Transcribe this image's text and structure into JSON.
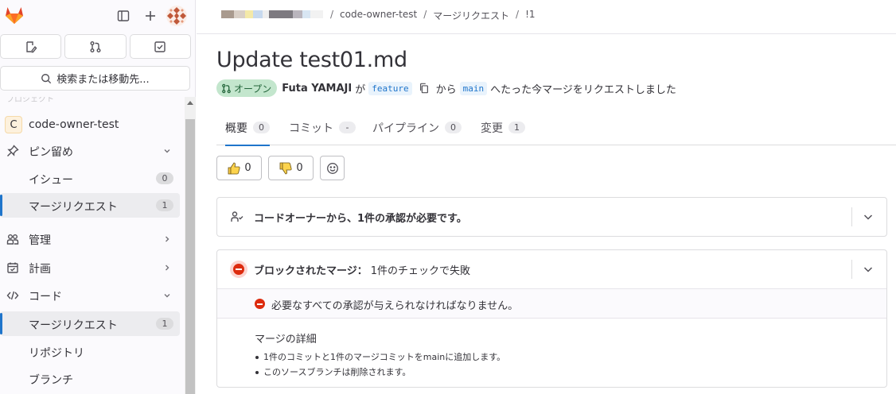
{
  "sidebar": {
    "search_label": "検索または移動先...",
    "project_initial": "C",
    "project_name": "code-owner-test",
    "items": [
      {
        "label": "ピン留め",
        "icon": "pin-icon"
      },
      {
        "label": "イシュー",
        "badge": "0"
      },
      {
        "label": "マージリクエスト",
        "badge": "1"
      },
      {
        "label": "管理",
        "icon": "users-icon"
      },
      {
        "label": "計画",
        "icon": "calendar-icon"
      },
      {
        "label": "コード",
        "icon": "code-icon"
      },
      {
        "label": "マージリクエスト",
        "badge": "1"
      },
      {
        "label": "リポジトリ"
      },
      {
        "label": "ブランチ"
      }
    ]
  },
  "breadcrumb": {
    "project": "code-owner-test",
    "section": "マージリクエスト",
    "current": "!1"
  },
  "mr": {
    "title": "Update test01.md",
    "status": "オープン",
    "author": "Futa YAMAJI",
    "text_ga": "が",
    "source_branch": "feature",
    "text_kara": "から",
    "target_branch": "main",
    "text_tail": "へたった今マージをリクエストしました"
  },
  "tabs": [
    {
      "label": "概要",
      "count": "0"
    },
    {
      "label": "コミット",
      "count": "-"
    },
    {
      "label": "パイプライン",
      "count": "0"
    },
    {
      "label": "変更",
      "count": "1"
    }
  ],
  "awards": {
    "thumbs_up": "0",
    "thumbs_down": "0"
  },
  "approvals_panel": {
    "text": "コードオーナーから、1件の承認が必要です。"
  },
  "merge_panel": {
    "title": "ブロックされたマージ：",
    "subtitle": "1件のチェックで失敗",
    "requirement": "必要なすべての承認が与えられなければなりません。",
    "details_title": "マージの詳細",
    "details": [
      "1件のコミットと1件のマージコミットをmainに追加します。",
      "このソースブランチは削除されます。"
    ]
  },
  "colors": {
    "accent": "#1f75cb",
    "open_badge_bg": "#c3e6cd",
    "open_badge_text": "#24663b",
    "danger": "#dd2b0e"
  }
}
